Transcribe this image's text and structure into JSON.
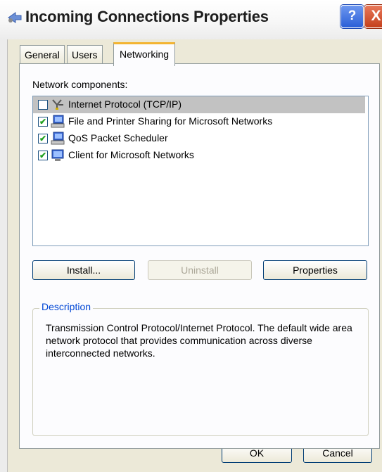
{
  "window": {
    "title": "Incoming Connections Properties",
    "help_label": "?",
    "close_label": "X"
  },
  "tabs": [
    {
      "label": "General"
    },
    {
      "label": "Users"
    },
    {
      "label": "Networking",
      "selected": true
    }
  ],
  "networking": {
    "components_label": "Network components:",
    "components": [
      {
        "label": "Internet Protocol (TCP/IP)",
        "checked": false,
        "selected": true,
        "icon": "protocol-icon"
      },
      {
        "label": "File and Printer Sharing for Microsoft Networks",
        "checked": true,
        "selected": false,
        "icon": "network-service-icon"
      },
      {
        "label": "QoS Packet Scheduler",
        "checked": true,
        "selected": false,
        "icon": "network-service-icon"
      },
      {
        "label": "Client for Microsoft Networks",
        "checked": true,
        "selected": false,
        "icon": "network-client-icon"
      }
    ],
    "install_label": "Install...",
    "uninstall_label": "Uninstall",
    "properties_label": "Properties",
    "description_title": "Description",
    "description_text": "Transmission Control Protocol/Internet Protocol. The default wide area network protocol that provides communication across diverse interconnected networks."
  },
  "footer": {
    "ok_label": "OK",
    "cancel_label": "Cancel"
  }
}
